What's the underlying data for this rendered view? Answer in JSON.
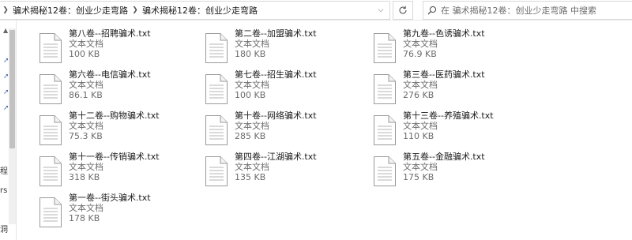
{
  "address_bar": {
    "breadcrumbs": [
      "骗术揭秘12卷：创业少走弯路",
      "骗术揭秘12卷：创业少走弯路"
    ]
  },
  "search": {
    "placeholder": "在 骗术揭秘12卷：创业少走弯路 中搜索"
  },
  "nav_pane": {
    "fragments": [
      "程",
      "rs",
      "洞"
    ]
  },
  "files": [
    {
      "name": "第八卷--招聘骗术.txt",
      "type": "文本文档",
      "size": "100 KB"
    },
    {
      "name": "第二卷--加盟骗术.txt",
      "type": "文本文档",
      "size": "180 KB"
    },
    {
      "name": "第九卷--色诱骗术.txt",
      "type": "文本文档",
      "size": "76.9 KB"
    },
    {
      "name": "第六卷--电信骗术.txt",
      "type": "文本文档",
      "size": "86.1 KB"
    },
    {
      "name": "第七卷--招生骗术.txt",
      "type": "文本文档",
      "size": "100 KB"
    },
    {
      "name": "第三卷--医药骗术.txt",
      "type": "文本文档",
      "size": "276 KB"
    },
    {
      "name": "第十二卷--购物骗术.txt",
      "type": "文本文档",
      "size": "75.3 KB"
    },
    {
      "name": "第十卷--网络骗术.txt",
      "type": "文本文档",
      "size": "285 KB"
    },
    {
      "name": "第十三卷--养殖骗术.txt",
      "type": "文本文档",
      "size": "110 KB"
    },
    {
      "name": "第十一卷--传销骗术.txt",
      "type": "文本文档",
      "size": "318 KB"
    },
    {
      "name": "第四卷--江湖骗术.txt",
      "type": "文本文档",
      "size": "135 KB"
    },
    {
      "name": "第五卷--金融骗术.txt",
      "type": "文本文档",
      "size": "175 KB"
    },
    {
      "name": "第一卷--街头骗术.txt",
      "type": "文本文档",
      "size": "178 KB"
    }
  ]
}
